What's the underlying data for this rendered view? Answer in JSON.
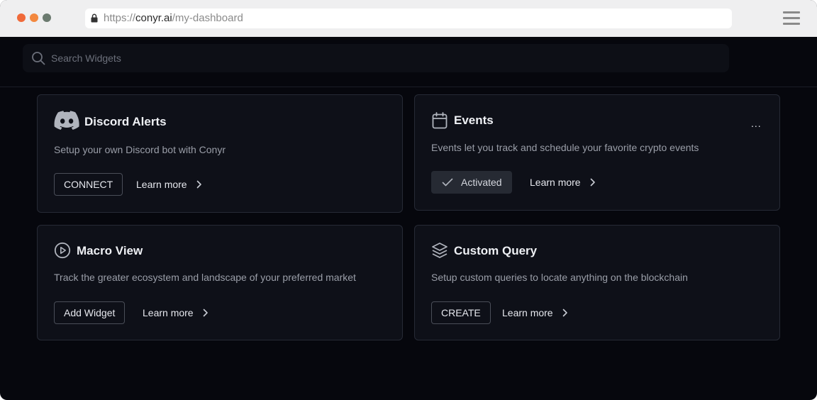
{
  "browser": {
    "url_scheme": "https://",
    "url_host": "conyr.ai",
    "url_path": "/my-dashboard"
  },
  "search": {
    "placeholder": "Search Widgets",
    "value": ""
  },
  "cards": [
    {
      "title": "Discord Alerts",
      "icon": "discord-icon",
      "description": "Setup your own Discord bot with Conyr",
      "button_label": "CONNECT",
      "learn_more": "Learn more"
    },
    {
      "title": "Events",
      "icon": "calendar-icon",
      "description": "Events let you track and schedule your favorite crypto events",
      "button_label": "Activated",
      "button_state": "activated",
      "learn_more": "Learn more",
      "menu": "..."
    },
    {
      "title": "Macro View",
      "icon": "play-circle-icon",
      "description": "Track the greater ecosystem and landscape of your preferred market",
      "button_label": "Add Widget",
      "learn_more": "Learn more"
    },
    {
      "title": "Custom Query",
      "icon": "layers-icon",
      "description": "Setup custom queries to locate anything on the blockchain",
      "button_label": "CREATE",
      "learn_more": "Learn more"
    }
  ],
  "colors": {
    "background": "#06070d",
    "card": "#0e1018",
    "card_border": "#262a35",
    "traffic_red": "#f06a3a",
    "traffic_orange": "#f3883f",
    "traffic_green": "#6b7a6f"
  }
}
